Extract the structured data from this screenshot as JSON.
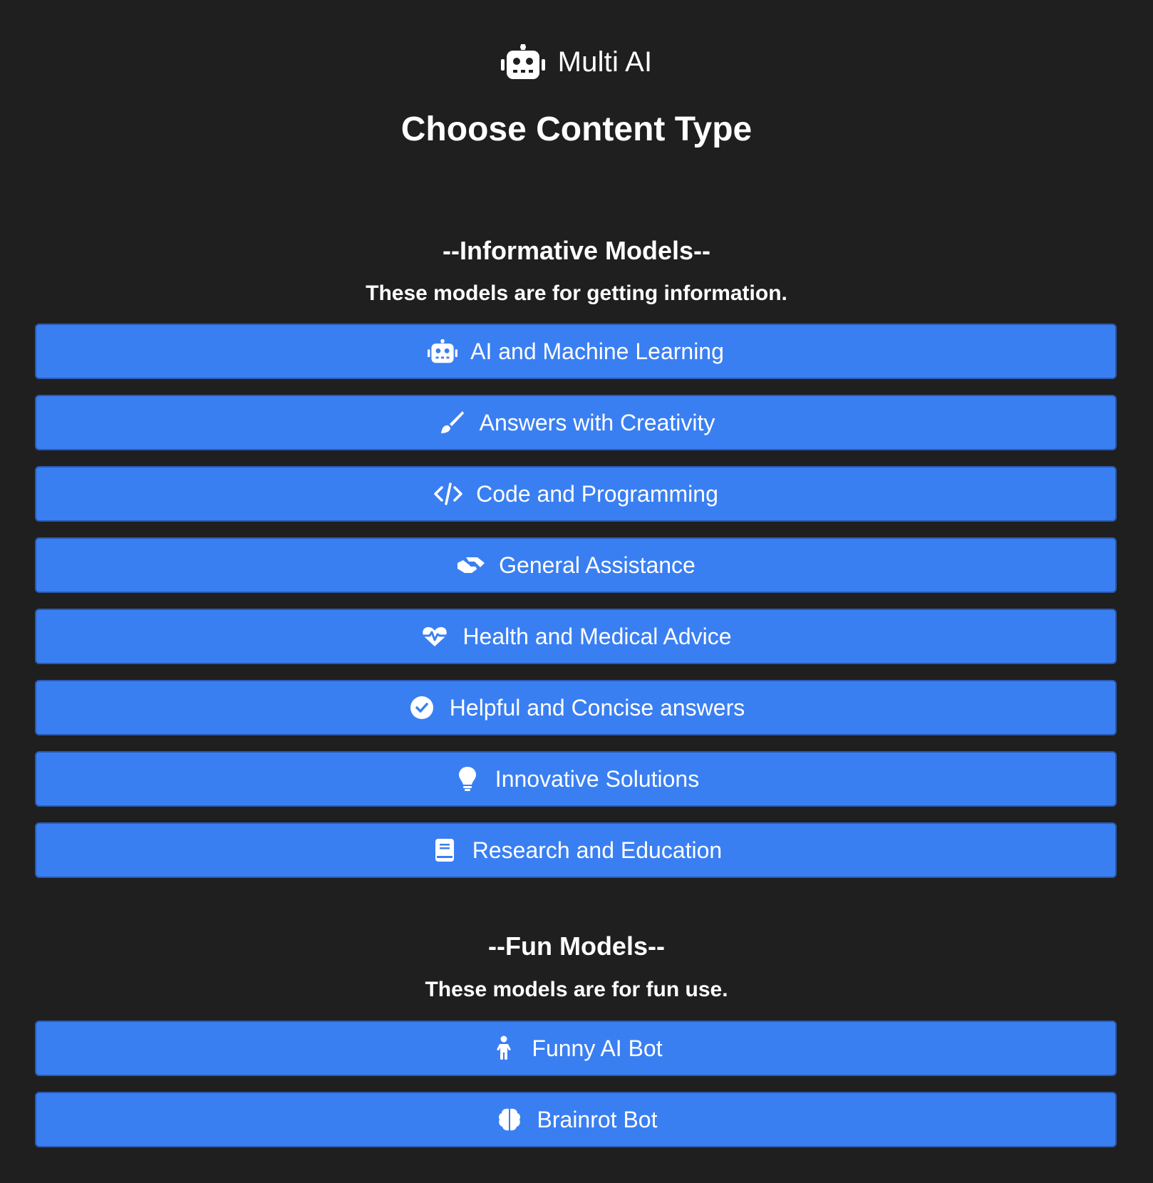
{
  "header": {
    "brand_name": "Multi AI",
    "brand_icon": "robot-icon",
    "title": "Choose Content Type"
  },
  "colors": {
    "background": "#1f1f1f",
    "button": "#3a7ff2",
    "text": "#ffffff"
  },
  "sections": [
    {
      "title": "--Informative Models--",
      "description": "These models are for getting information.",
      "buttons": [
        {
          "label": "AI and Machine Learning",
          "icon": "robot-icon"
        },
        {
          "label": "Answers with Creativity",
          "icon": "paintbrush-icon"
        },
        {
          "label": "Code and Programming",
          "icon": "code-icon"
        },
        {
          "label": "General Assistance",
          "icon": "handshake-icon"
        },
        {
          "label": "Health and Medical Advice",
          "icon": "heart-pulse-icon"
        },
        {
          "label": "Helpful and Concise answers",
          "icon": "check-circle-icon"
        },
        {
          "label": "Innovative Solutions",
          "icon": "lightbulb-icon"
        },
        {
          "label": "Research and Education",
          "icon": "book-icon"
        }
      ]
    },
    {
      "title": "--Fun Models--",
      "description": "These models are for fun use.",
      "buttons": [
        {
          "label": "Funny AI Bot",
          "icon": "child-icon"
        },
        {
          "label": "Brainrot Bot",
          "icon": "brain-icon"
        }
      ]
    }
  ]
}
